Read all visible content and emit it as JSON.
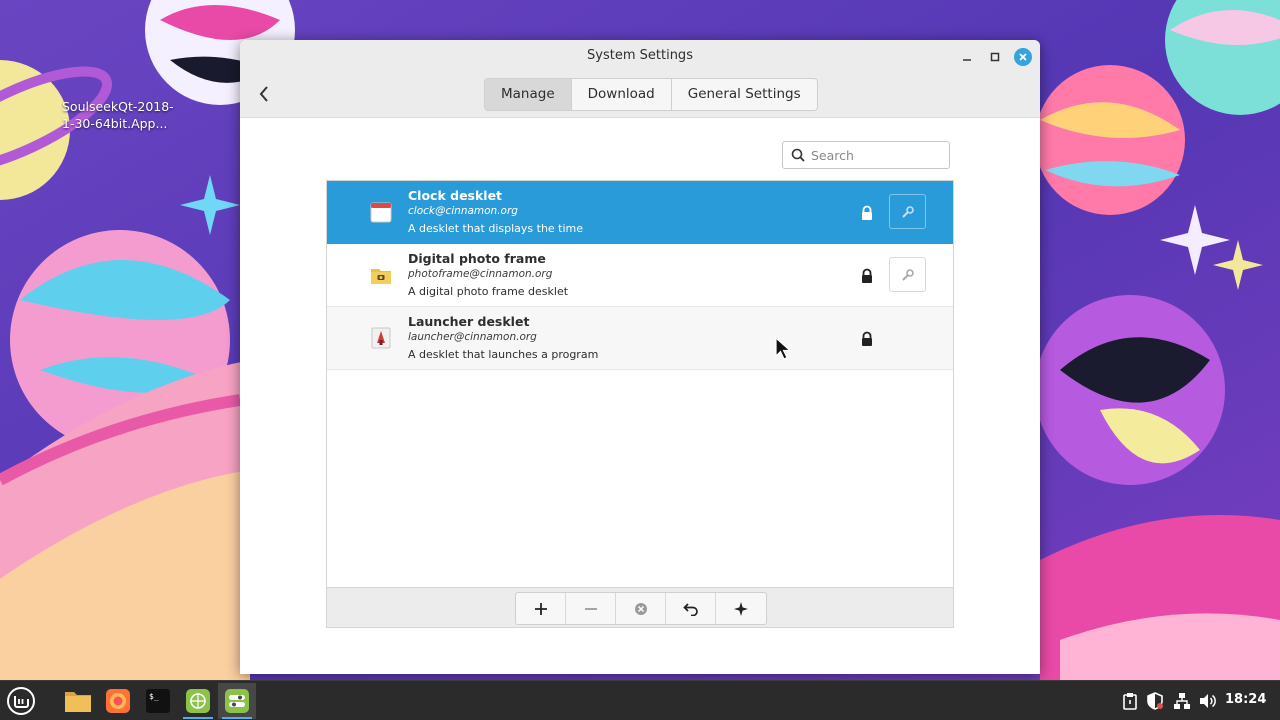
{
  "desktop": {
    "icon_label": "SoulseekQt-2018-1-30-64bit.App..."
  },
  "window": {
    "title": "System Settings",
    "tabs": [
      {
        "label": "Manage",
        "active": true
      },
      {
        "label": "Download",
        "active": false
      },
      {
        "label": "General Settings",
        "active": false
      }
    ],
    "search_placeholder": "Search",
    "desklets": [
      {
        "name": "Clock desklet",
        "uuid": "clock@cinnamon.org",
        "description": "A desklet that displays the time",
        "icon": "calendar-icon",
        "locked": true,
        "configurable": true,
        "selected": true
      },
      {
        "name": "Digital photo frame",
        "uuid": "photoframe@cinnamon.org",
        "description": "A digital photo frame desklet",
        "icon": "photo-folder-icon",
        "locked": true,
        "configurable": true,
        "selected": false
      },
      {
        "name": "Launcher desklet",
        "uuid": "launcher@cinnamon.org",
        "description": "A desklet that launches a program",
        "icon": "launcher-icon",
        "locked": true,
        "configurable": false,
        "selected": false
      }
    ],
    "toolbar": [
      "add-icon",
      "remove-icon",
      "clear-icon",
      "undo-icon",
      "sparkle-icon"
    ]
  },
  "taskbar": {
    "clock": "18:24",
    "launchers": [
      "mint-menu-icon",
      "files-icon",
      "firefox-icon",
      "terminal-icon",
      "web-app-icon",
      "settings-icon"
    ],
    "tray": [
      "clipboard-icon",
      "shield-icon",
      "network-icon",
      "volume-icon"
    ]
  },
  "colors": {
    "selection": "#2a9bd9",
    "close_button": "#35a4dd",
    "wallpaper": "#5a3fb0",
    "taskbar": "#2b2b2b"
  }
}
